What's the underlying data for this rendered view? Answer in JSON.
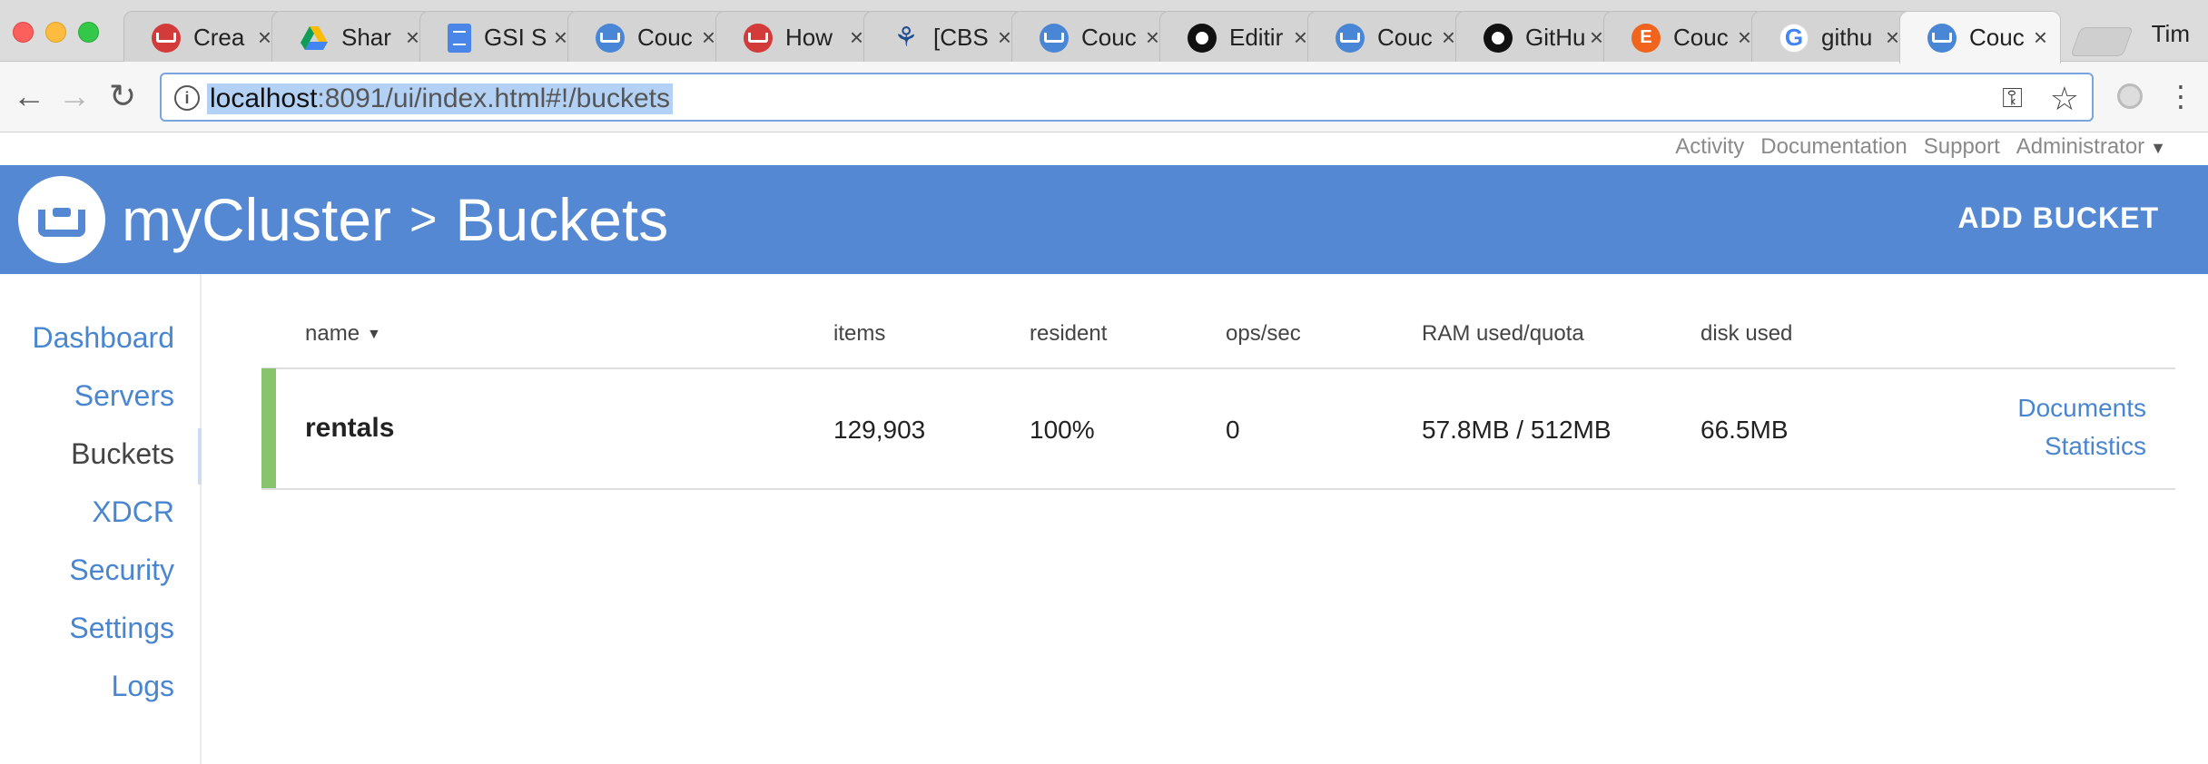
{
  "browser": {
    "tabs": [
      {
        "title": "Crea",
        "favicon": "cb-red",
        "active": false
      },
      {
        "title": "Shar",
        "favicon": "drive",
        "active": false
      },
      {
        "title": "GSI S",
        "favicon": "docs",
        "active": false
      },
      {
        "title": "Couc",
        "favicon": "cb-blue",
        "active": false
      },
      {
        "title": "How",
        "favicon": "cb-red",
        "active": false
      },
      {
        "title": "[CBS",
        "favicon": "jira",
        "active": false
      },
      {
        "title": "Couc",
        "favicon": "cb-blue",
        "active": false
      },
      {
        "title": "Editir",
        "favicon": "gh",
        "active": false
      },
      {
        "title": "Couc",
        "favicon": "cb-blue",
        "active": false
      },
      {
        "title": "GitHu",
        "favicon": "gh",
        "active": false
      },
      {
        "title": "Couc",
        "favicon": "etsy",
        "active": false
      },
      {
        "title": "githu",
        "favicon": "google",
        "active": false
      },
      {
        "title": "Couc",
        "favicon": "cb-blue",
        "active": true
      }
    ],
    "tab_close_glyph": "×",
    "profile_name": "Tim",
    "url_host": "localhost",
    "url_path": ":8091/ui/index.html#!/buckets"
  },
  "header": {
    "utility_links": [
      "Activity",
      "Documentation",
      "Support",
      "Administrator"
    ],
    "cluster_name": "myCluster",
    "separator": ">",
    "page_title": "Buckets",
    "add_bucket_label": "ADD BUCKET"
  },
  "sidebar": {
    "items": [
      {
        "label": "Dashboard",
        "active": false
      },
      {
        "label": "Servers",
        "active": false
      },
      {
        "label": "Buckets",
        "active": true
      },
      {
        "label": "XDCR",
        "active": false
      },
      {
        "label": "Security",
        "active": false
      },
      {
        "label": "Settings",
        "active": false
      },
      {
        "label": "Logs",
        "active": false
      }
    ]
  },
  "bucket_table": {
    "columns": [
      "name",
      "items",
      "resident",
      "ops/sec",
      "RAM used/quota",
      "disk used"
    ],
    "sorted_by": "name",
    "rows": [
      {
        "name": "rentals",
        "items": "129,903",
        "resident": "100%",
        "ops_sec": "0",
        "ram": "57.8MB / 512MB",
        "disk": "66.5MB",
        "links": [
          "Documents",
          "Statistics"
        ],
        "status_color": "#87c46c"
      }
    ]
  },
  "colors": {
    "brand_blue": "#5488d2",
    "link_blue": "#4a86cf",
    "healthy_green": "#87c46c"
  }
}
